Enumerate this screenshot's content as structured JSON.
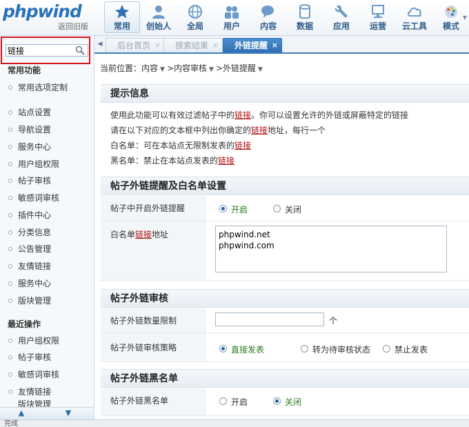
{
  "logo": {
    "brand": "phpwind",
    "sub": "返回旧版"
  },
  "nav": [
    {
      "label": "常用",
      "icon": "star-icon",
      "active": true
    },
    {
      "label": "创始人",
      "icon": "person-icon"
    },
    {
      "label": "全局",
      "icon": "globe-icon"
    },
    {
      "label": "用户",
      "icon": "users-icon"
    },
    {
      "label": "内容",
      "icon": "chat-icon"
    },
    {
      "label": "数据",
      "icon": "database-icon"
    },
    {
      "label": "应用",
      "icon": "wrench-icon"
    },
    {
      "label": "运营",
      "icon": "monitor-icon"
    },
    {
      "label": "云工具",
      "icon": "cloud-icon"
    },
    {
      "label": "模式",
      "icon": "palette-icon"
    }
  ],
  "search": {
    "value": "链接"
  },
  "sidebar": {
    "heading_common": "常用功能",
    "common_items": [
      "常用选项定制"
    ],
    "items": [
      "站点设置",
      "导航设置",
      "服务中心",
      "用户组权限",
      "帖子审核",
      "敏感词审核",
      "插件中心",
      "分类信息",
      "公告管理",
      "友情链接",
      "服务中心",
      "版块管理"
    ],
    "heading_recent": "最近操作",
    "recent_items": [
      "用户组权限",
      "帖子审核",
      "敏感词审核",
      "友情链接",
      "版块管理"
    ]
  },
  "tabs": [
    {
      "label": "后台首页",
      "active": false
    },
    {
      "label": "搜索结果",
      "active": false
    },
    {
      "label": "外链提醒",
      "active": true
    }
  ],
  "breadcrumb": {
    "prefix": "当前位置",
    "items": [
      "内容",
      "内容审核",
      "外链提醒"
    ]
  },
  "tips": {
    "title": "提示信息",
    "line1_a": "使用此功能可以有效过滤帖子中的",
    "line1_kw": "链接",
    "line1_b": "。你可以设置允许的外链或屏蔽特定的链接",
    "line2_a": "请在以下对应的文本框中列出你确定的",
    "line2_kw": "链接",
    "line2_b": "地址，每行一个",
    "line3_a": "白名单：可在本站点无限制发表的",
    "line3_kw": "链接",
    "line4_a": "黑名单：禁止在本站点发表的",
    "line4_kw": "链接"
  },
  "section_whitelist": {
    "title": "帖子外链提醒及白名单设置",
    "enable_label": "帖子中开启外链提醒",
    "enable_on": "开启",
    "enable_off": "关闭",
    "addr_label_a": "白名单",
    "addr_label_kw": "链接",
    "addr_label_b": "地址",
    "whitelist_line1": "phpwind.net",
    "whitelist_line2": "phpwind.com"
  },
  "section_audit": {
    "title": "帖子外链审核",
    "limit_label": "帖子外链数量限制",
    "limit_value": "",
    "limit_unit": "个",
    "strategy_label": "帖子外链审核策略",
    "opt_direct": "直接发表",
    "opt_pending": "转为待审核状态",
    "opt_forbid": "禁止发表"
  },
  "section_blacklist": {
    "title": "帖子外链黑名单",
    "label": "帖子外链黑名单",
    "on": "开启",
    "off": "关闭"
  },
  "status": {
    "text": "完成"
  },
  "colors": {
    "accent": "#2e6fb3",
    "keyword": "#b01010",
    "highlight_border": "#d6141a"
  }
}
